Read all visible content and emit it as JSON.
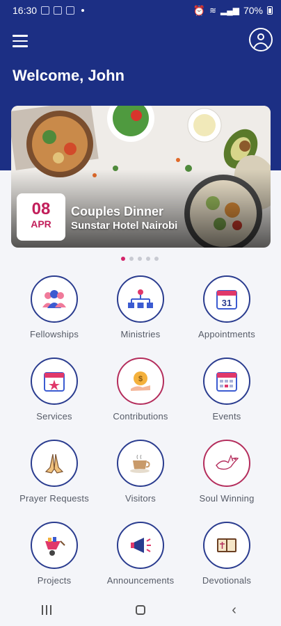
{
  "status_bar": {
    "time": "16:30",
    "battery": "70%"
  },
  "header": {
    "welcome": "Welcome, John"
  },
  "banner": {
    "day": "08",
    "month": "APR",
    "title": "Couples Dinner",
    "venue": "Sunstar Hotel Nairobi"
  },
  "carousel": {
    "count": 5,
    "active_index": 0
  },
  "grid": {
    "items": [
      {
        "label": "Fellowships",
        "icon": "people-group-icon"
      },
      {
        "label": "Ministries",
        "icon": "hierarchy-icon"
      },
      {
        "label": "Appointments",
        "icon": "calendar-31-icon"
      },
      {
        "label": "Services",
        "icon": "calendar-star-icon"
      },
      {
        "label": "Contributions",
        "icon": "money-bag-hand-icon"
      },
      {
        "label": "Events",
        "icon": "calendar-grid-icon"
      },
      {
        "label": "Prayer Requests",
        "icon": "praying-hands-icon"
      },
      {
        "label": "Visitors",
        "icon": "coffee-cup-icon"
      },
      {
        "label": "Soul Winning",
        "icon": "dove-icon"
      },
      {
        "label": "Projects",
        "icon": "wheelbarrow-icon"
      },
      {
        "label": "Announcements",
        "icon": "megaphone-icon"
      },
      {
        "label": "Devotionals",
        "icon": "bible-icon"
      }
    ]
  },
  "colors": {
    "brand_blue": "#1c2f84",
    "accent_pink": "#d4236a"
  }
}
